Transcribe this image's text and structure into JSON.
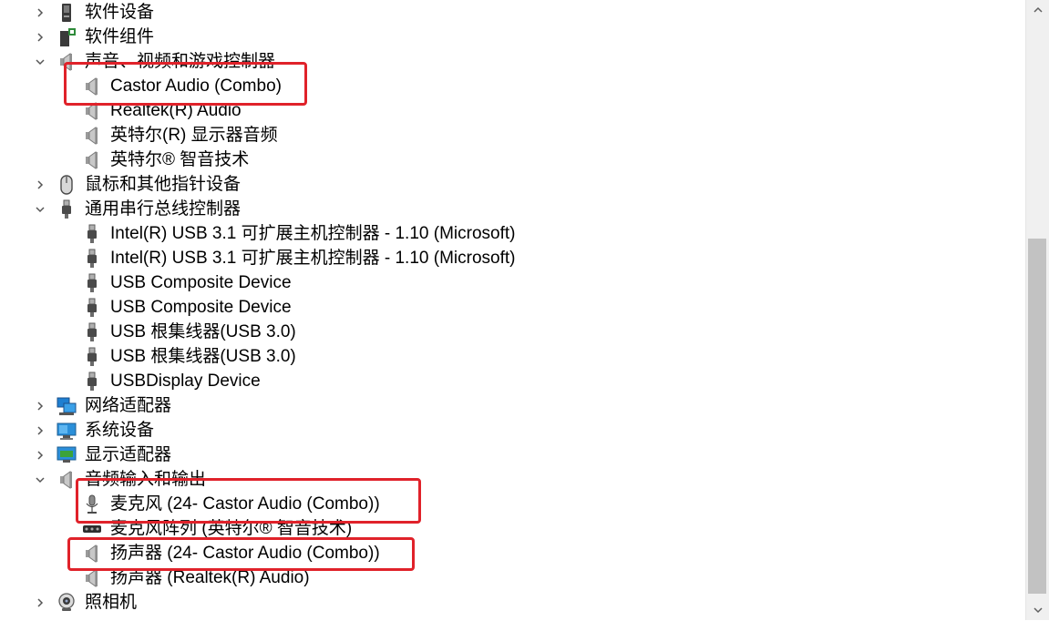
{
  "tree": [
    {
      "kind": "category",
      "expanded": false,
      "icon": "software-device-icon",
      "label": "软件设备"
    },
    {
      "kind": "category",
      "expanded": false,
      "icon": "software-component-icon",
      "label": "软件组件"
    },
    {
      "kind": "category",
      "expanded": true,
      "icon": "speaker-icon",
      "label": "声音、视频和游戏控制器"
    },
    {
      "kind": "device",
      "icon": "speaker-icon",
      "label": "Castor Audio (Combo)"
    },
    {
      "kind": "device",
      "icon": "speaker-icon",
      "label": "Realtek(R) Audio"
    },
    {
      "kind": "device",
      "icon": "speaker-icon",
      "label": "英特尔(R) 显示器音频"
    },
    {
      "kind": "device",
      "icon": "speaker-icon",
      "label": "英特尔® 智音技术"
    },
    {
      "kind": "category",
      "expanded": false,
      "icon": "mouse-icon",
      "label": "鼠标和其他指针设备"
    },
    {
      "kind": "category",
      "expanded": true,
      "icon": "usb-plug-icon",
      "label": "通用串行总线控制器"
    },
    {
      "kind": "device",
      "icon": "usb-plug-icon",
      "label": "Intel(R) USB 3.1 可扩展主机控制器 - 1.10 (Microsoft)"
    },
    {
      "kind": "device",
      "icon": "usb-plug-icon",
      "label": "Intel(R) USB 3.1 可扩展主机控制器 - 1.10 (Microsoft)"
    },
    {
      "kind": "device",
      "icon": "usb-plug-icon",
      "label": "USB Composite Device"
    },
    {
      "kind": "device",
      "icon": "usb-plug-icon",
      "label": "USB Composite Device"
    },
    {
      "kind": "device",
      "icon": "usb-plug-icon",
      "label": "USB 根集线器(USB 3.0)"
    },
    {
      "kind": "device",
      "icon": "usb-plug-icon",
      "label": "USB 根集线器(USB 3.0)"
    },
    {
      "kind": "device",
      "icon": "usb-plug-icon",
      "label": "USBDisplay Device"
    },
    {
      "kind": "category",
      "expanded": false,
      "icon": "network-adapter-icon",
      "label": "网络适配器"
    },
    {
      "kind": "category",
      "expanded": false,
      "icon": "system-device-icon",
      "label": "系统设备"
    },
    {
      "kind": "category",
      "expanded": false,
      "icon": "display-adapter-icon",
      "label": "显示适配器"
    },
    {
      "kind": "category",
      "expanded": true,
      "icon": "speaker-icon",
      "label": "音频输入和输出"
    },
    {
      "kind": "device",
      "icon": "microphone-icon",
      "label": "麦克风 (24- Castor Audio (Combo))"
    },
    {
      "kind": "device",
      "icon": "mic-array-icon",
      "label": "麦克风阵列 (英特尔® 智音技术)"
    },
    {
      "kind": "device",
      "icon": "speaker-icon",
      "label": "扬声器 (24- Castor Audio (Combo))"
    },
    {
      "kind": "device",
      "icon": "speaker-icon",
      "label": "扬声器 (Realtek(R) Audio)"
    },
    {
      "kind": "category",
      "expanded": false,
      "icon": "camera-icon",
      "label": "照相机"
    }
  ],
  "annotations": {
    "highlight_color": "#e0222a",
    "count": 3
  },
  "colors": {
    "chevron": "#555555",
    "scrollbar_thumb": "#c2c2c2",
    "scrollbar_track": "#f0f0f0"
  }
}
